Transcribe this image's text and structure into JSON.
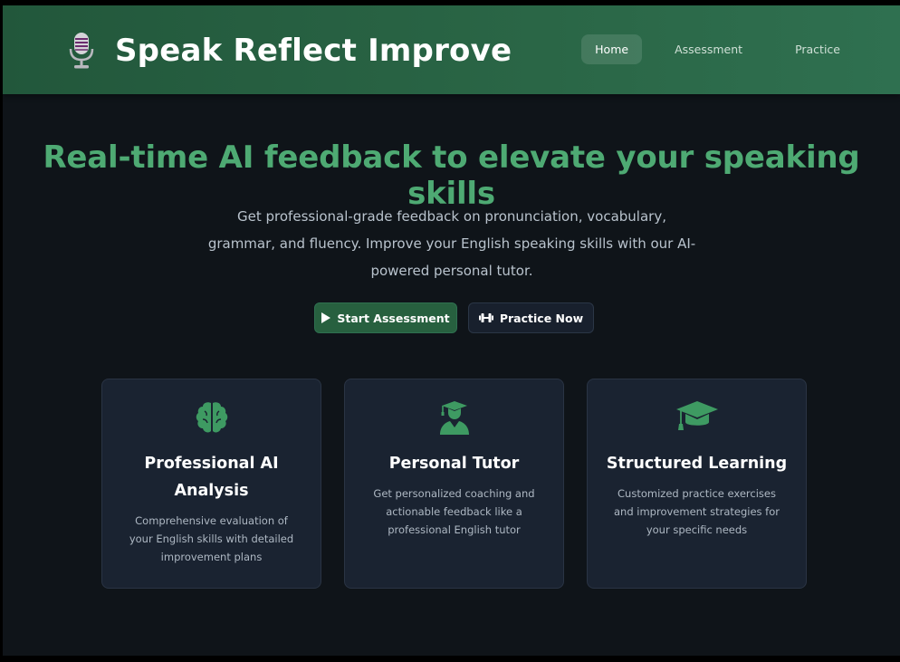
{
  "header": {
    "title": "Speak Reflect Improve",
    "logo_icon": "microphone-icon",
    "nav": [
      {
        "label": "Home",
        "active": true
      },
      {
        "label": "Assessment",
        "active": false
      },
      {
        "label": "Practice",
        "active": false
      }
    ]
  },
  "hero": {
    "title": "Real-time AI feedback to elevate your speaking skills",
    "description": "Get professional-grade feedback on pronunciation, vocabulary, grammar, and fluency. Improve your English speaking skills with our AI-powered personal tutor.",
    "primary_button": {
      "label": "Start Assessment",
      "icon": "play-icon"
    },
    "secondary_button": {
      "label": "Practice Now",
      "icon": "dumbbell-icon"
    }
  },
  "features": [
    {
      "icon": "brain-icon",
      "title": "Professional AI Analysis",
      "description": "Comprehensive evaluation of your English skills with detailed improvement plans"
    },
    {
      "icon": "user-graduate-icon",
      "title": "Personal Tutor",
      "description": "Get personalized coaching and actionable feedback like a professional English tutor"
    },
    {
      "icon": "graduation-cap-icon",
      "title": "Structured Learning",
      "description": "Customized practice exercises and improvement strategies for your specific needs"
    }
  ],
  "colors": {
    "header_bg": "#2a6646",
    "page_bg": "#0f1419",
    "accent": "#4eaa73",
    "card_bg": "#1a2331",
    "primary_button_bg": "#27603f"
  }
}
